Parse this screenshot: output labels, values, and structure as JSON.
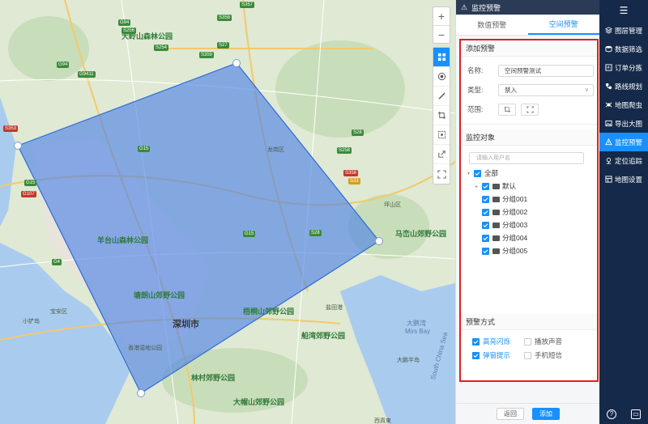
{
  "map": {
    "city_label": "深圳市",
    "labels": [
      {
        "text": "大岭山森林公园",
        "cls": "park"
      },
      {
        "text": "羊台山森林公园",
        "cls": "park"
      },
      {
        "text": "塘朗山郊野公园",
        "cls": "park"
      },
      {
        "text": "马峦山郊野公园",
        "cls": "park"
      },
      {
        "text": "梧桐山郊野公园",
        "cls": "park"
      },
      {
        "text": "大鹏半岛",
        "cls": ""
      },
      {
        "text": "Mirs Bay",
        "cls": "sea"
      },
      {
        "text": "大鹏湾",
        "cls": "sea"
      },
      {
        "text": "宝安区",
        "cls": ""
      },
      {
        "text": "龙岗区",
        "cls": ""
      },
      {
        "text": "坪山区",
        "cls": ""
      },
      {
        "text": "小铲岛",
        "cls": ""
      },
      {
        "text": "香港湿地公园",
        "cls": ""
      },
      {
        "text": "船湾郊野公园",
        "cls": "park"
      },
      {
        "text": "林村郊野公园",
        "cls": "park"
      },
      {
        "text": "大帽山郊野公园",
        "cls": "park"
      },
      {
        "text": "盐田港",
        "cls": ""
      },
      {
        "text": "西貢東",
        "cls": ""
      },
      {
        "text": "South China Sea",
        "cls": "sea"
      }
    ],
    "badges": [
      "S357",
      "S358",
      "G94",
      "G9411",
      "S359",
      "S256",
      "S254",
      "S353",
      "S258",
      "G15",
      "G107",
      "S358",
      "S33",
      "G4",
      "G15",
      "S28",
      "S27",
      "S28",
      "G15",
      "G94"
    ]
  },
  "toolbar": {
    "zoom_in": "+",
    "zoom_out": "−"
  },
  "panel": {
    "title": "监控预警",
    "tabs": [
      {
        "label": "数值预警",
        "active": false
      },
      {
        "label": "空间预警",
        "active": true
      }
    ],
    "add_section_title": "添加预警",
    "name_label": "名称:",
    "name_value": "空间预警测试",
    "type_label": "类型:",
    "type_value": "禁入",
    "range_label": "范围:",
    "target_section_title": "监控对象",
    "user_search_placeholder": "请输入用户名",
    "tree": [
      {
        "label": "全部",
        "level": 0,
        "checked": true
      },
      {
        "label": "默认",
        "level": 1,
        "checked": true,
        "folder": true,
        "caret": true
      },
      {
        "label": "分组001",
        "level": 1,
        "checked": true,
        "folder": true
      },
      {
        "label": "分组002",
        "level": 1,
        "checked": true,
        "folder": true
      },
      {
        "label": "分组003",
        "level": 1,
        "checked": true,
        "folder": true
      },
      {
        "label": "分组004",
        "level": 1,
        "checked": true,
        "folder": true
      },
      {
        "label": "分组005",
        "level": 1,
        "checked": true,
        "folder": true
      }
    ],
    "alarm_section_title": "预警方式",
    "alarm_options": [
      {
        "label": "高亮闪烁",
        "checked": true
      },
      {
        "label": "播放声音",
        "checked": false
      },
      {
        "label": "弹窗提示",
        "checked": true
      },
      {
        "label": "手机短信",
        "checked": false
      }
    ],
    "back_label": "返回",
    "add_label": "添加"
  },
  "sidebar": {
    "items": [
      {
        "label": "图层管理",
        "icon": "layers-icon",
        "active": false
      },
      {
        "label": "数据筛选",
        "icon": "filter-icon",
        "active": false
      },
      {
        "label": "订单分拣",
        "icon": "order-icon",
        "active": false
      },
      {
        "label": "路线规划",
        "icon": "route-icon",
        "active": false
      },
      {
        "label": "地图爬虫",
        "icon": "spider-icon",
        "active": false
      },
      {
        "label": "导出大图",
        "icon": "image-icon",
        "active": false
      },
      {
        "label": "监控预警",
        "icon": "monitor-icon",
        "active": true
      },
      {
        "label": "定位追踪",
        "icon": "track-icon",
        "active": false
      },
      {
        "label": "地图设置",
        "icon": "settings-icon",
        "active": false
      }
    ]
  },
  "colors": {
    "accent": "#1890ff",
    "sidebar_bg": "#152a4a",
    "polygon_fill": "#4a7fe8",
    "highlight_border": "#e02020"
  }
}
